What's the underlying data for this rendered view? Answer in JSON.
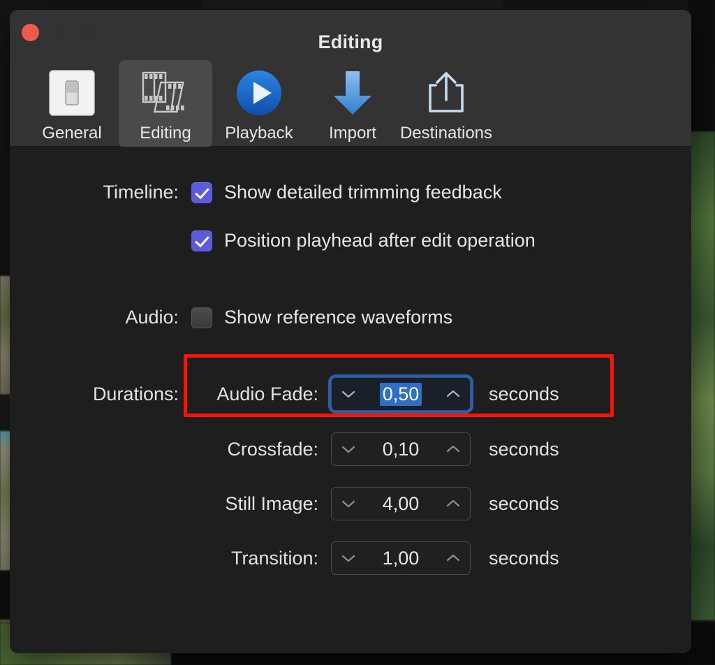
{
  "window": {
    "title": "Editing",
    "traffic_lights": [
      {
        "name": "close",
        "color": "#ee5a4b"
      },
      {
        "name": "minimize",
        "color": "#323232"
      },
      {
        "name": "zoom",
        "color": "#323232"
      }
    ]
  },
  "toolbar": {
    "selected": "Editing",
    "items": [
      {
        "label": "General",
        "icon": "toggle-switch-icon"
      },
      {
        "label": "Editing",
        "icon": "film-strips-icon"
      },
      {
        "label": "Playback",
        "icon": "play-circle-icon"
      },
      {
        "label": "Import",
        "icon": "download-arrow-icon"
      },
      {
        "label": "Destinations",
        "icon": "share-export-icon"
      }
    ]
  },
  "settings": {
    "timeline": {
      "label": "Timeline:",
      "checkboxes": [
        {
          "label": "Show detailed trimming feedback",
          "checked": true
        },
        {
          "label": "Position playhead after edit operation",
          "checked": true
        }
      ]
    },
    "audio": {
      "label": "Audio:",
      "checkboxes": [
        {
          "label": "Show reference waveforms",
          "checked": false
        }
      ]
    },
    "durations": {
      "label": "Durations:",
      "unit": "seconds",
      "fields": [
        {
          "label": "Audio Fade:",
          "value": "0,50",
          "focused": true
        },
        {
          "label": "Crossfade:",
          "value": "0,10",
          "focused": false
        },
        {
          "label": "Still Image:",
          "value": "4,00",
          "focused": false
        },
        {
          "label": "Transition:",
          "value": "1,00",
          "focused": false
        }
      ]
    }
  },
  "annotation": {
    "name": "audio-fade-highlight",
    "color": "#ff1100"
  }
}
